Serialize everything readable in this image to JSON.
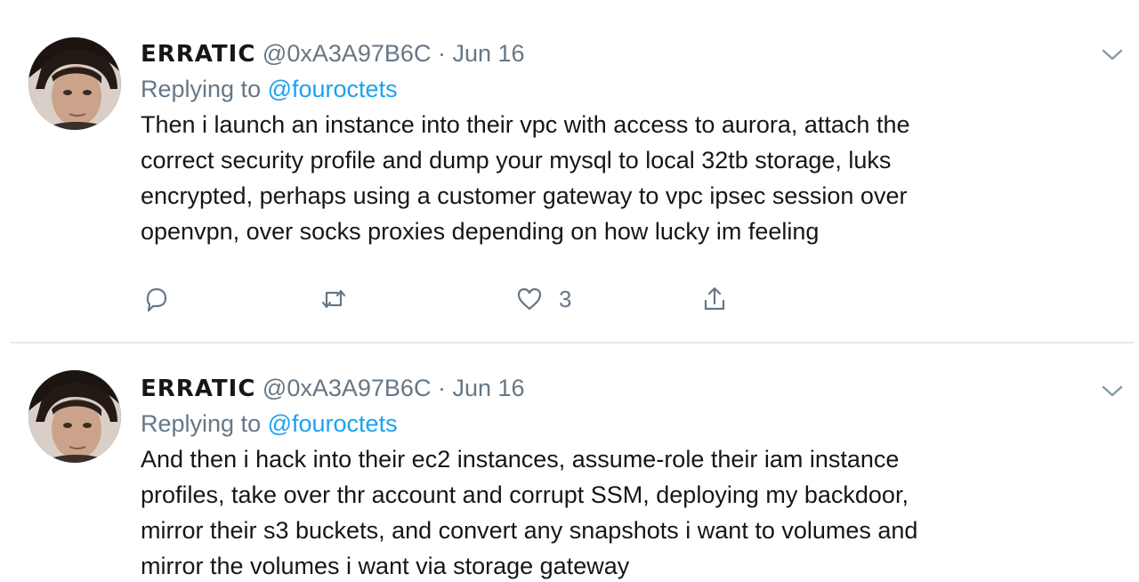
{
  "tweets": [
    {
      "display_name": "ERRATIC",
      "handle": "@0xA3A97B6C",
      "separator": "·",
      "date": "Jun 16",
      "replying_prefix": "Replying to",
      "replying_to": "@fouroctets",
      "text_lines": [
        "Then i launch an instance into their vpc with access to aurora, attach the",
        "correct security profile and dump your mysql to local 32tb storage, luks",
        "encrypted, perhaps using a customer gateway to vpc ipsec session over",
        "openvpn, over socks proxies depending on how lucky im feeling"
      ],
      "like_count": "3"
    },
    {
      "display_name": "ERRATIC",
      "handle": "@0xA3A97B6C",
      "separator": "·",
      "date": "Jun 16",
      "replying_prefix": "Replying to",
      "replying_to": "@fouroctets",
      "text_lines": [
        "And then i hack into their ec2 instances, assume-role their iam instance",
        "profiles, take over thr account and corrupt SSM, deploying my backdoor,",
        "mirror their s3 buckets, and convert any snapshots i want to volumes and",
        "mirror the volumes i want via storage gateway"
      ]
    }
  ],
  "icons": {
    "reply": "reply-icon",
    "retweet": "retweet-icon",
    "like": "like-icon",
    "share": "share-icon",
    "caret": "chevron-down-icon"
  },
  "colors": {
    "link": "#1da1f2",
    "secondary_text": "#657786",
    "divider": "#e6ecf0"
  }
}
